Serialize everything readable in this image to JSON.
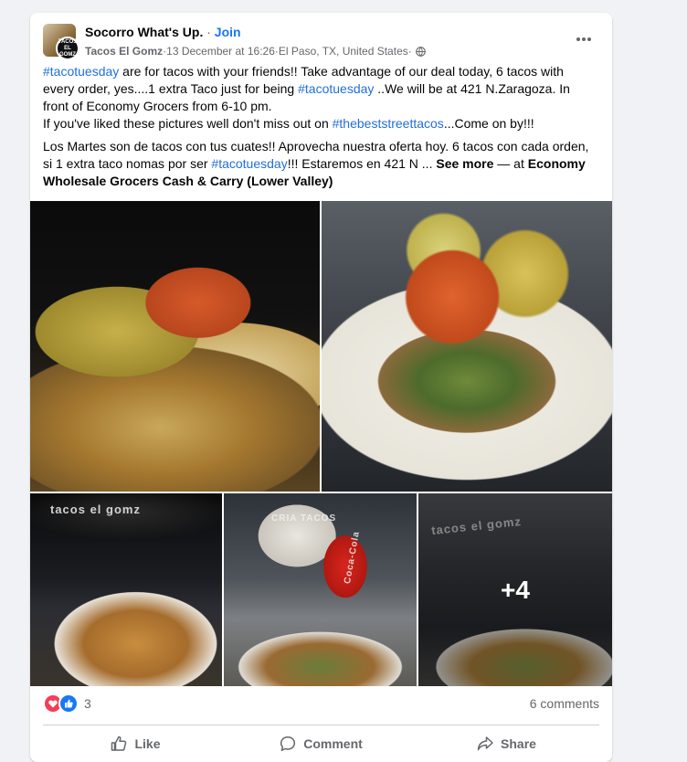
{
  "post": {
    "group_name": "Socorro What's Up.",
    "separator": " · ",
    "join_label": "Join",
    "author": "Tacos El Gomz",
    "meta_sep": " · ",
    "date": "13 December at 16:26",
    "location": "El Paso, TX, United States",
    "page_avatar_text_1": "TACOS",
    "page_avatar_text_2": "EL",
    "page_avatar_text_3": "GOMZ",
    "body": {
      "p1": {
        "tag1": "#tacotuesday",
        "t1": " are for tacos with your friends!! Take advantage of our deal today, 6 tacos with every order, yes....1 extra Taco just for being ",
        "tag2": "#tacotuesday",
        "t2": " ..We will be at 421 N.Zaragoza. In front of Economy Grocers from 6-10 pm.",
        "t3": "If you've liked these pictures well don't miss out on ",
        "tag3": "#thebeststreettacos",
        "t4": "...Come on by!!!"
      },
      "p2": {
        "t1": "Los Martes son de tacos con tus cuates!! Aprovecha nuestra oferta hoy. 6 tacos con cada orden, si 1 extra taco nomas por ser ",
        "tag1": "#tacotuesday",
        "t2": "!!! Estaremos en 421 N ... ",
        "see_more": "See more",
        "t3": " — at ",
        "place": "Economy Wholesale Grocers Cash & Carry (Lower Valley)"
      }
    },
    "photos": {
      "more_count": "+4",
      "sign_3": "tacos el gomz",
      "sign_4": "CRIA TACOS",
      "can_label": "Coca-Cola",
      "sign_5": "tacos el gomz"
    },
    "reactions": {
      "count": "3",
      "comments": "6 comments"
    },
    "actions": {
      "like": "Like",
      "comment": "Comment",
      "share": "Share"
    }
  },
  "colors": {
    "link_blue": "#1877f2",
    "hashtag_blue": "#216fdb",
    "secondary_text": "#65676b",
    "love_red": "#f33e58"
  }
}
